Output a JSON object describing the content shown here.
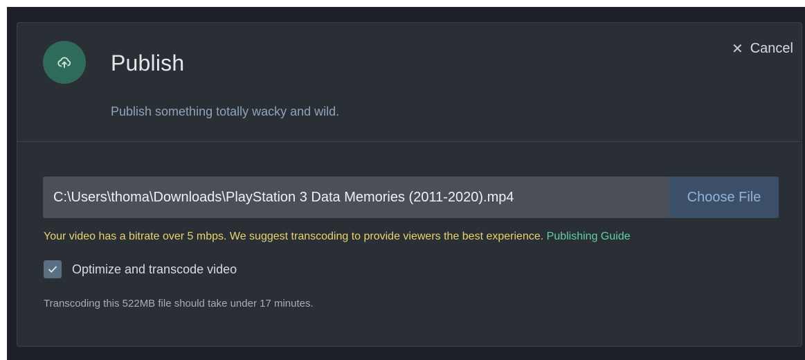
{
  "dialog": {
    "title": "Publish",
    "subtitle": "Publish something totally wacky and wild.",
    "cancel_label": "Cancel",
    "icon": "cloud-upload-icon",
    "accent_color": "#2f6b5a"
  },
  "file": {
    "path": "C:\\Users\\thoma\\Downloads\\PlayStation 3 Data Memories (2011-2020).mp4",
    "choose_label": "Choose File"
  },
  "warning": {
    "text": "Your video has a bitrate over 5 mbps. We suggest transcoding to provide viewers the best experience. ",
    "link_label": "Publishing Guide",
    "color": "#e8d46a"
  },
  "transcode": {
    "checked": true,
    "label": "Optimize and transcode video",
    "note": "Transcoding this 522MB file should take under 17 minutes."
  }
}
